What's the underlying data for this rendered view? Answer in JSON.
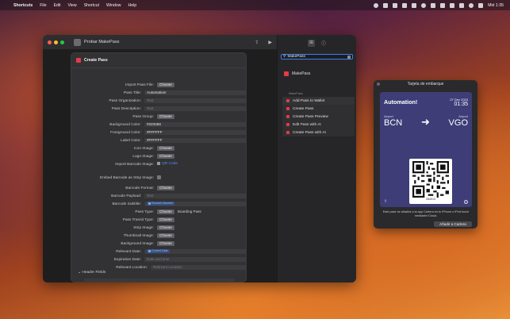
{
  "menubar": {
    "app": "Shortcuts",
    "items": [
      "File",
      "Edit",
      "View",
      "Shortcut",
      "Window",
      "Help"
    ],
    "clock": "Mié 1:35"
  },
  "window": {
    "title": "Probar MakePass"
  },
  "action": {
    "title": "Create Pass",
    "rows": [
      {
        "label": "Import Pass File:",
        "kind": "chip",
        "value": "Choose"
      },
      {
        "label": "Pass Title:",
        "kind": "field",
        "value": "Automation!"
      },
      {
        "label": "Pass Organization:",
        "kind": "placeholder",
        "value": "Text"
      },
      {
        "label": "Pass Description:",
        "kind": "placeholder",
        "value": "Text"
      },
      {
        "label": "Pass Group:",
        "kind": "chip",
        "value": "Choose"
      },
      {
        "label": "Background Color:",
        "kind": "field",
        "value": "#323456"
      },
      {
        "label": "Foreground Color:",
        "kind": "field",
        "value": "#FFFFFF"
      },
      {
        "label": "Label Color:",
        "kind": "field",
        "value": "#FFFFFF"
      },
      {
        "label": "Icon Image:",
        "kind": "chip",
        "value": "Choose"
      },
      {
        "label": "Logo Image:",
        "kind": "chip",
        "value": "Choose"
      },
      {
        "label": "Import Barcode Image:",
        "kind": "link",
        "value": "QR Code"
      },
      {
        "label": "Embed Barcode as Strip Image:",
        "kind": "toggle",
        "value": ""
      },
      {
        "label": "Barcode Format:",
        "kind": "chip",
        "value": "Choose"
      },
      {
        "label": "Barcode Payload:",
        "kind": "placeholder",
        "value": "Text"
      },
      {
        "label": "Barcode Subtitle:",
        "kind": "variable",
        "value": "Random Number"
      },
      {
        "label": "Pass Type:",
        "kind": "chip-side",
        "value": "Choose",
        "side": "Boarding Pass"
      },
      {
        "label": "Pass Transit Type:",
        "kind": "chip",
        "value": "Choose"
      },
      {
        "label": "Strip Image:",
        "kind": "chip",
        "value": "Choose"
      },
      {
        "label": "Thumbnail Image:",
        "kind": "chip",
        "value": "Choose"
      },
      {
        "label": "Background Image:",
        "kind": "chip",
        "value": "Choose"
      },
      {
        "label": "Relevant Date:",
        "kind": "variable",
        "value": "Current Date"
      },
      {
        "label": "Expiration Date:",
        "kind": "placeholder",
        "value": "Date and time"
      },
      {
        "label": "Relevant Location:",
        "kind": "placeholder",
        "value": "Relevant Location"
      }
    ],
    "header_fields": "Header Fields"
  },
  "library": {
    "search_value": "MakePass",
    "app_result": "MakePass",
    "section": "MakePass",
    "actions": [
      "Add Pass to Wallet",
      "Create Pass",
      "Create Pass Preview",
      "Edit Pass with AI",
      "Create Pass with AI"
    ]
  },
  "preview": {
    "window_title": "Tarjeta de embarque",
    "org": "Automation!",
    "date": "27 Dec 2023",
    "time": "01:35",
    "from_label": "Airport",
    "to_label": "Airport",
    "from": "BCN",
    "to": "VGO",
    "barcode_text": "284013",
    "note": "Este pase se añadirá a la app Cartera en tu iPhone o iPod touch mediante iCloud.",
    "add_button": "Añadir a Cartera",
    "accent": "#323456"
  }
}
